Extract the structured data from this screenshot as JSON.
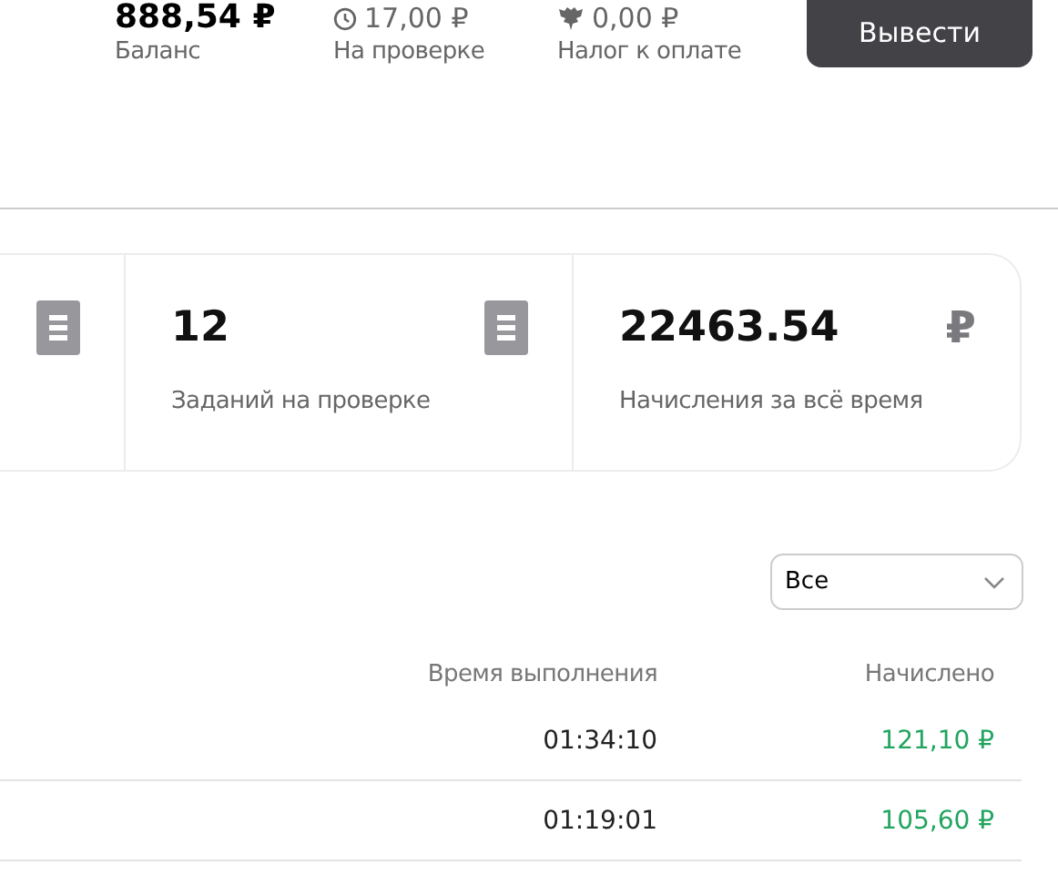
{
  "header": {
    "balance": {
      "value": "888,54 ₽",
      "label": "Баланс"
    },
    "pending": {
      "value": "17,00 ₽",
      "label": "На проверке"
    },
    "tax": {
      "value": "0,00 ₽",
      "label": "Налог к оплате"
    },
    "withdraw_button": "Вывести"
  },
  "stats": [
    {
      "kind": "document"
    },
    {
      "value": "12",
      "label": "Заданий на проверке",
      "kind": "document"
    },
    {
      "value": "22463.54",
      "label": "Начисления за всё время",
      "kind": "currency",
      "symbol": "₽"
    }
  ],
  "filter": {
    "value": "Все"
  },
  "table": {
    "columns": [
      "Время выполнения",
      "Начислено"
    ],
    "rows": [
      {
        "time": "01:34:10",
        "amount": "121,10 ₽"
      },
      {
        "time": "01:19:01",
        "amount": "105,60 ₽"
      }
    ]
  }
}
